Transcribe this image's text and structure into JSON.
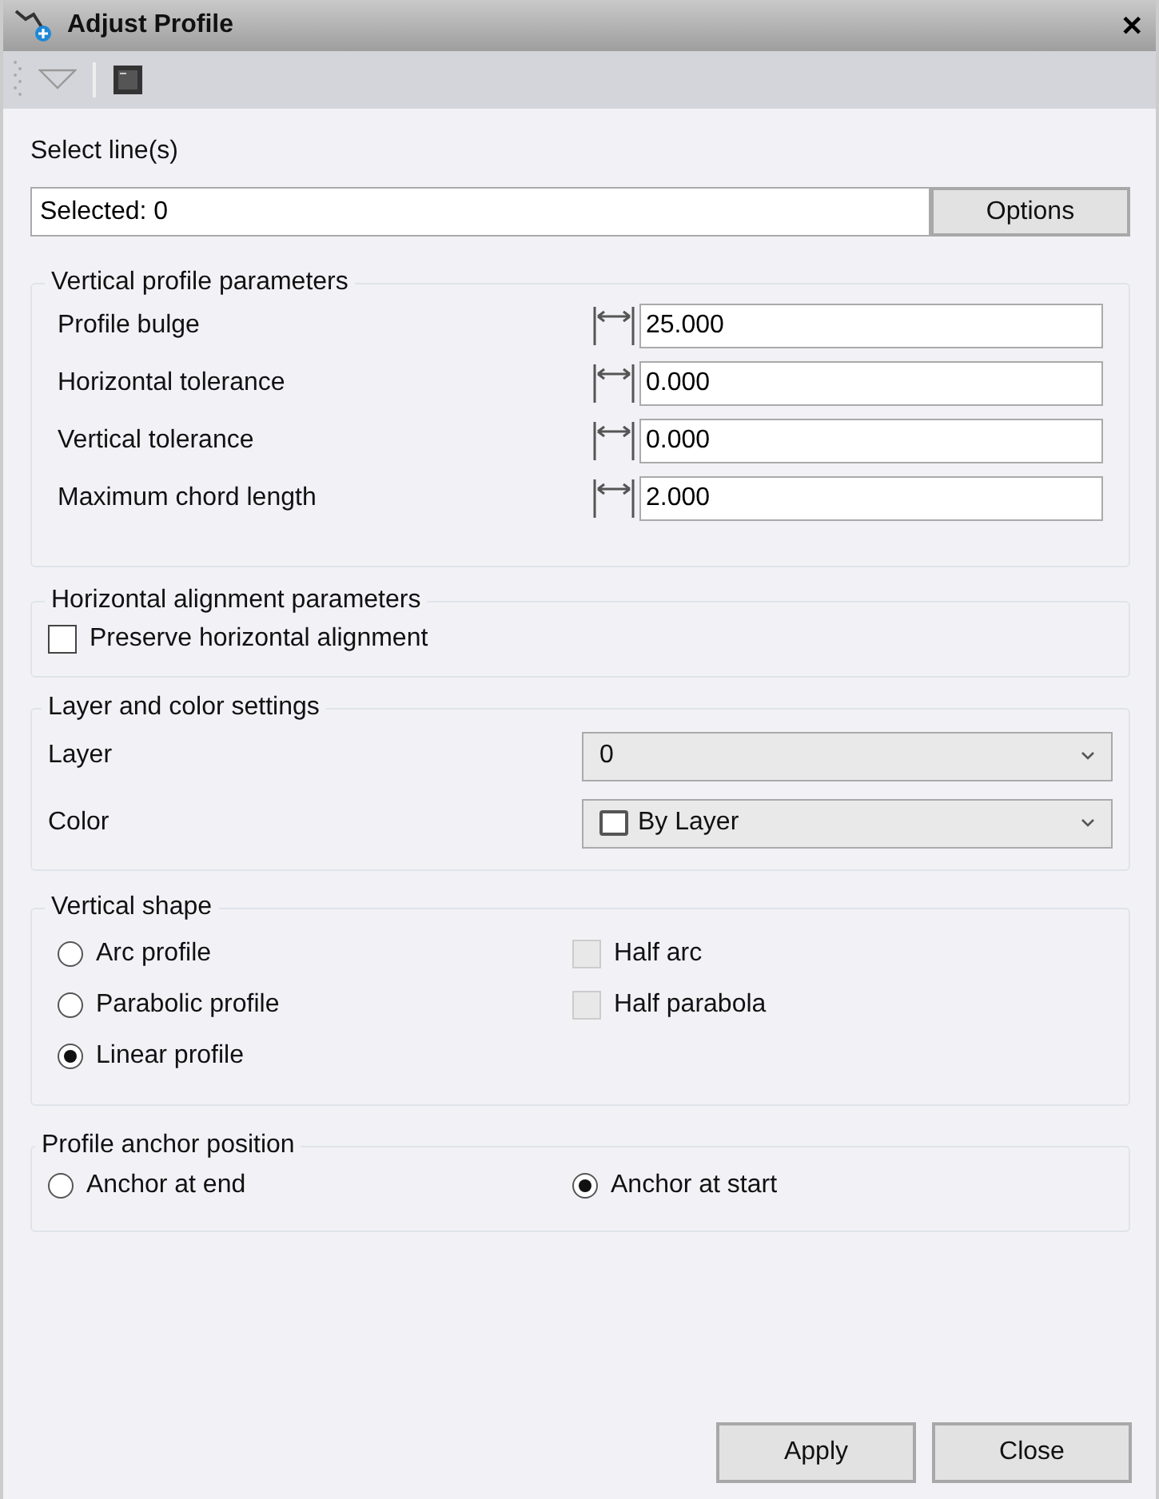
{
  "window": {
    "title": "Adjust Profile",
    "close": "✕"
  },
  "selection": {
    "label": "Select line(s)",
    "value": "Selected: 0",
    "button": "Options"
  },
  "vertical_profile": {
    "title": "Vertical profile parameters",
    "fields": [
      {
        "label": "Profile bulge",
        "value": "25.000"
      },
      {
        "label": "Horizontal tolerance",
        "value": "0.000"
      },
      {
        "label": "Vertical tolerance",
        "value": "0.000"
      },
      {
        "label": "Maximum chord length",
        "value": "2.000"
      }
    ]
  },
  "horizontal_alignment": {
    "title": "Horizontal alignment parameters",
    "checkbox": {
      "label": "Preserve horizontal alignment",
      "checked": false
    }
  },
  "layer_color": {
    "title": "Layer and color settings",
    "rows": [
      {
        "label": "Layer",
        "value": "0",
        "kind": "plain"
      },
      {
        "label": "Color",
        "value": "By Layer",
        "kind": "color"
      }
    ]
  },
  "vertical_shape": {
    "title": "Vertical shape",
    "radios": [
      {
        "label": "Arc profile",
        "selected": false
      },
      {
        "label": "Parabolic profile",
        "selected": false
      },
      {
        "label": "Linear profile",
        "selected": true
      }
    ],
    "checkboxes": [
      {
        "label": "Half arc",
        "checked": false,
        "disabled": true
      },
      {
        "label": "Half parabola",
        "checked": false,
        "disabled": true
      }
    ]
  },
  "anchor": {
    "title": "Profile anchor position",
    "radios": [
      {
        "label": "Anchor at end",
        "selected": false
      },
      {
        "label": "Anchor at start",
        "selected": true
      }
    ]
  },
  "buttons": [
    "Apply",
    "Close"
  ]
}
